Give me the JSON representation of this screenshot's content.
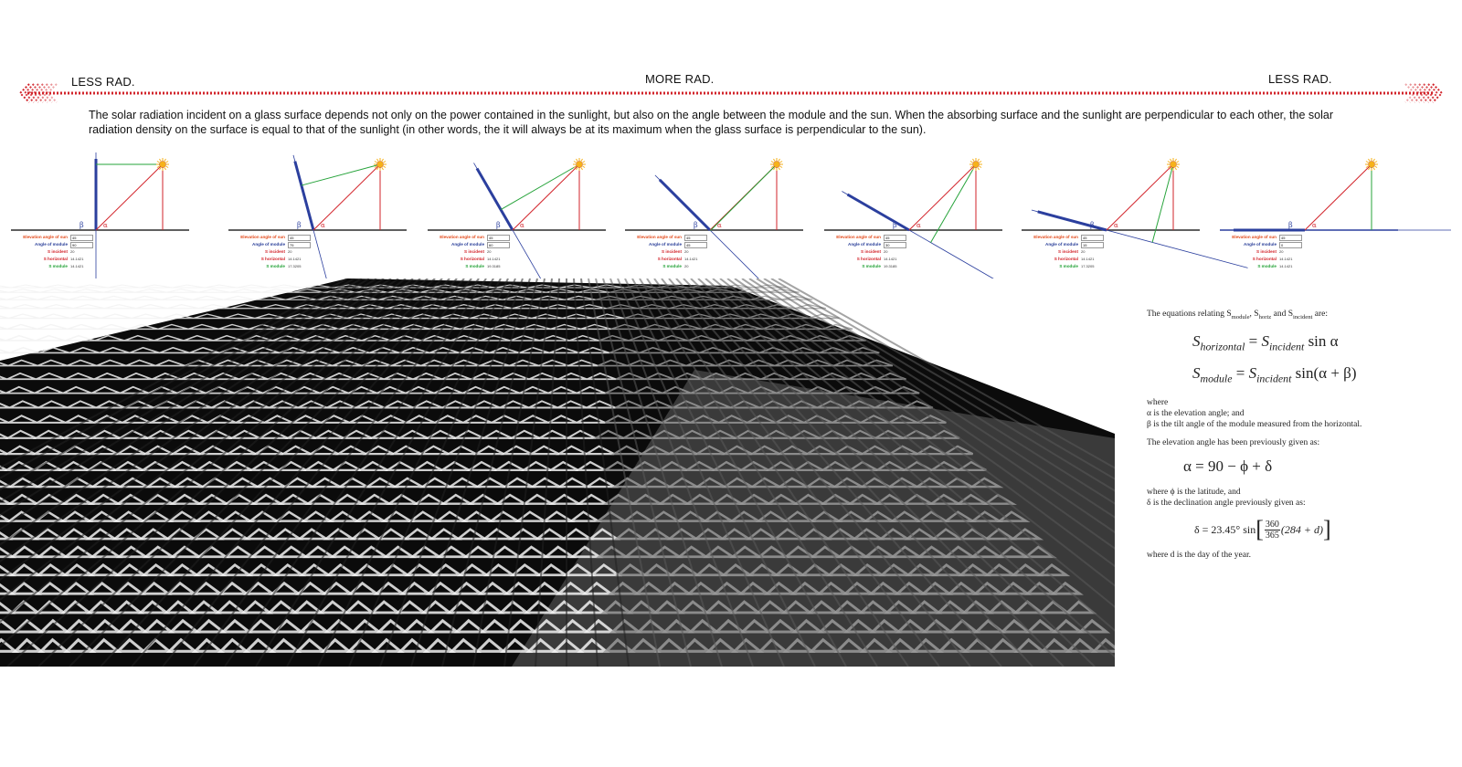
{
  "scale": {
    "left_label": "LESS RAD.",
    "center_label": "MORE RAD.",
    "right_label": "LESS RAD.",
    "arrow_color": "#d2232a"
  },
  "intro_text": "The solar radiation incident on a glass surface depends not only on the power contained in the sunlight, but also on the angle between the module and the sun. When the absorbing surface and the sunlight are perpendicular to each other, the solar radiation density on the surface is equal to that of the sunlight (in other words, the it will always be at its maximum when the glass surface is perpendicular to the sun).",
  "diagram_labels": {
    "elevation": "Elevation angle of sun",
    "angle_module": "Angle of module",
    "s_incident": "S incident",
    "s_horizontal": "S horizontal",
    "s_module": "S module",
    "beta": "β",
    "alpha": "α"
  },
  "diagrams": [
    {
      "elevation": "45",
      "module_angle": "90",
      "s_incident": "20",
      "s_horizontal": "14.1421",
      "s_module": "14.1421"
    },
    {
      "elevation": "45",
      "module_angle": "75",
      "s_incident": "20",
      "s_horizontal": "14.1421",
      "s_module": "17.3205"
    },
    {
      "elevation": "45",
      "module_angle": "60",
      "s_incident": "20",
      "s_horizontal": "14.1421",
      "s_module": "19.3185"
    },
    {
      "elevation": "45",
      "module_angle": "45",
      "s_incident": "20",
      "s_horizontal": "14.1421",
      "s_module": "20"
    },
    {
      "elevation": "45",
      "module_angle": "30",
      "s_incident": "20",
      "s_horizontal": "14.1421",
      "s_module": "19.3185"
    },
    {
      "elevation": "45",
      "module_angle": "15",
      "s_incident": "20",
      "s_horizontal": "14.1421",
      "s_module": "17.3205"
    },
    {
      "elevation": "45",
      "module_angle": "0",
      "s_incident": "20",
      "s_horizontal": "14.1421",
      "s_module": "14.1421"
    }
  ],
  "colors": {
    "module": "#2b3f9e",
    "incident": "#d2232a",
    "horizontal_ref": "#26a33a",
    "ground": "#2b2b2b",
    "sun": "#f6b21a"
  },
  "equations": {
    "intro_pre": "The equations relating S",
    "sub_module": "module",
    "sep1": ", S",
    "sub_horiz": "horiz",
    "sep2": " and S",
    "sub_incident": "incident",
    "intro_post": " are:",
    "eq1_lhs": "S",
    "eq1_lhs_sub": "horizontal",
    "eq1_rhs": "S",
    "eq1_rhs_sub": "incident",
    "eq1_fn": "sin α",
    "eq2_lhs": "S",
    "eq2_lhs_sub": "module",
    "eq2_rhs": "S",
    "eq2_rhs_sub": "incident",
    "eq2_fn": "sin(α + β)",
    "where": "where",
    "alpha_def": "α is the elevation angle; and",
    "beta_def": "β is the tilt angle of the module measured from the horizontal.",
    "elev_intro": "The elevation angle has been previously given as:",
    "eq3": "α = 90 − ϕ + δ",
    "phi_def": "where ϕ is the latitude, and",
    "delta_intro": "δ is the declination angle previously given as:",
    "eq4_lhs": "δ = 23.45° sin",
    "eq4_num": "360",
    "eq4_den": "365",
    "eq4_tail": "(284 + d)",
    "d_def": "where d is the day of the year."
  }
}
